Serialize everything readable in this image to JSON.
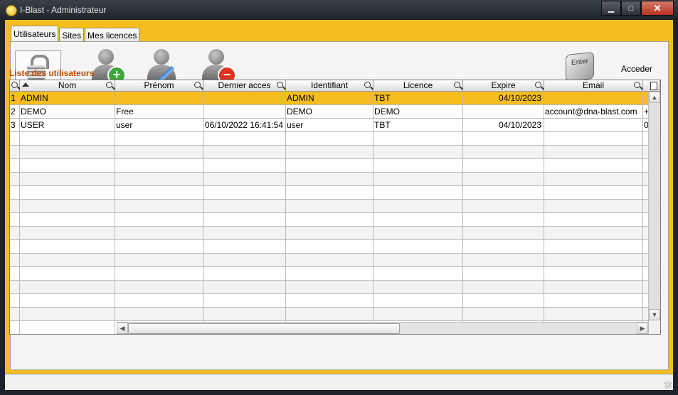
{
  "window": {
    "title": "I-Blast - Administrateur",
    "minimize_icon": "minimize-icon",
    "maximize_icon": "maximize-icon",
    "close_icon": "close-icon",
    "minimize_glyph": "▁",
    "maximize_glyph": "□",
    "close_glyph": "✕"
  },
  "tabs": [
    {
      "label": "Utilisateurs",
      "active": true
    },
    {
      "label": "Sites",
      "active": false
    },
    {
      "label": "Mes licences",
      "active": false
    }
  ],
  "toolbar": {
    "lock_icon": "padlock-open-icon",
    "add_user_icon": "add-user-icon",
    "edit_user_icon": "edit-user-icon",
    "delete_user_icon": "delete-user-icon",
    "enter_key_label": "Enter",
    "acceder_label": "Acceder"
  },
  "list_title": "Liste des utilisateurs",
  "table": {
    "columns": [
      "",
      "Nom",
      "Prénom",
      "Dernier acces",
      "Identifiant",
      "Licence",
      "Expire",
      "Email",
      ""
    ],
    "sort_column": "Nom",
    "rows": [
      {
        "num": "1",
        "nom": "ADMIN",
        "prenom": "",
        "dernier_acces": "",
        "identifiant": "ADMIN",
        "licence": "TBT",
        "expire": "04/10/2023",
        "email": "",
        "extra": "",
        "selected": true
      },
      {
        "num": "2",
        "nom": "DEMO",
        "prenom": "Free",
        "dernier_acces": "",
        "identifiant": "DEMO",
        "licence": "DEMO",
        "expire": "",
        "email": "account@dna-blast.com",
        "extra": "+",
        "selected": false
      },
      {
        "num": "3",
        "nom": "USER",
        "prenom": "user",
        "dernier_acces": "06/10/2022 16:41:54",
        "identifiant": "user",
        "licence": "TBT",
        "expire": "04/10/2023",
        "email": "",
        "extra": "0",
        "selected": false
      }
    ],
    "empty_row_count": 15
  },
  "colors": {
    "accent": "#f5bd1f",
    "list_title": "#c04e00"
  }
}
